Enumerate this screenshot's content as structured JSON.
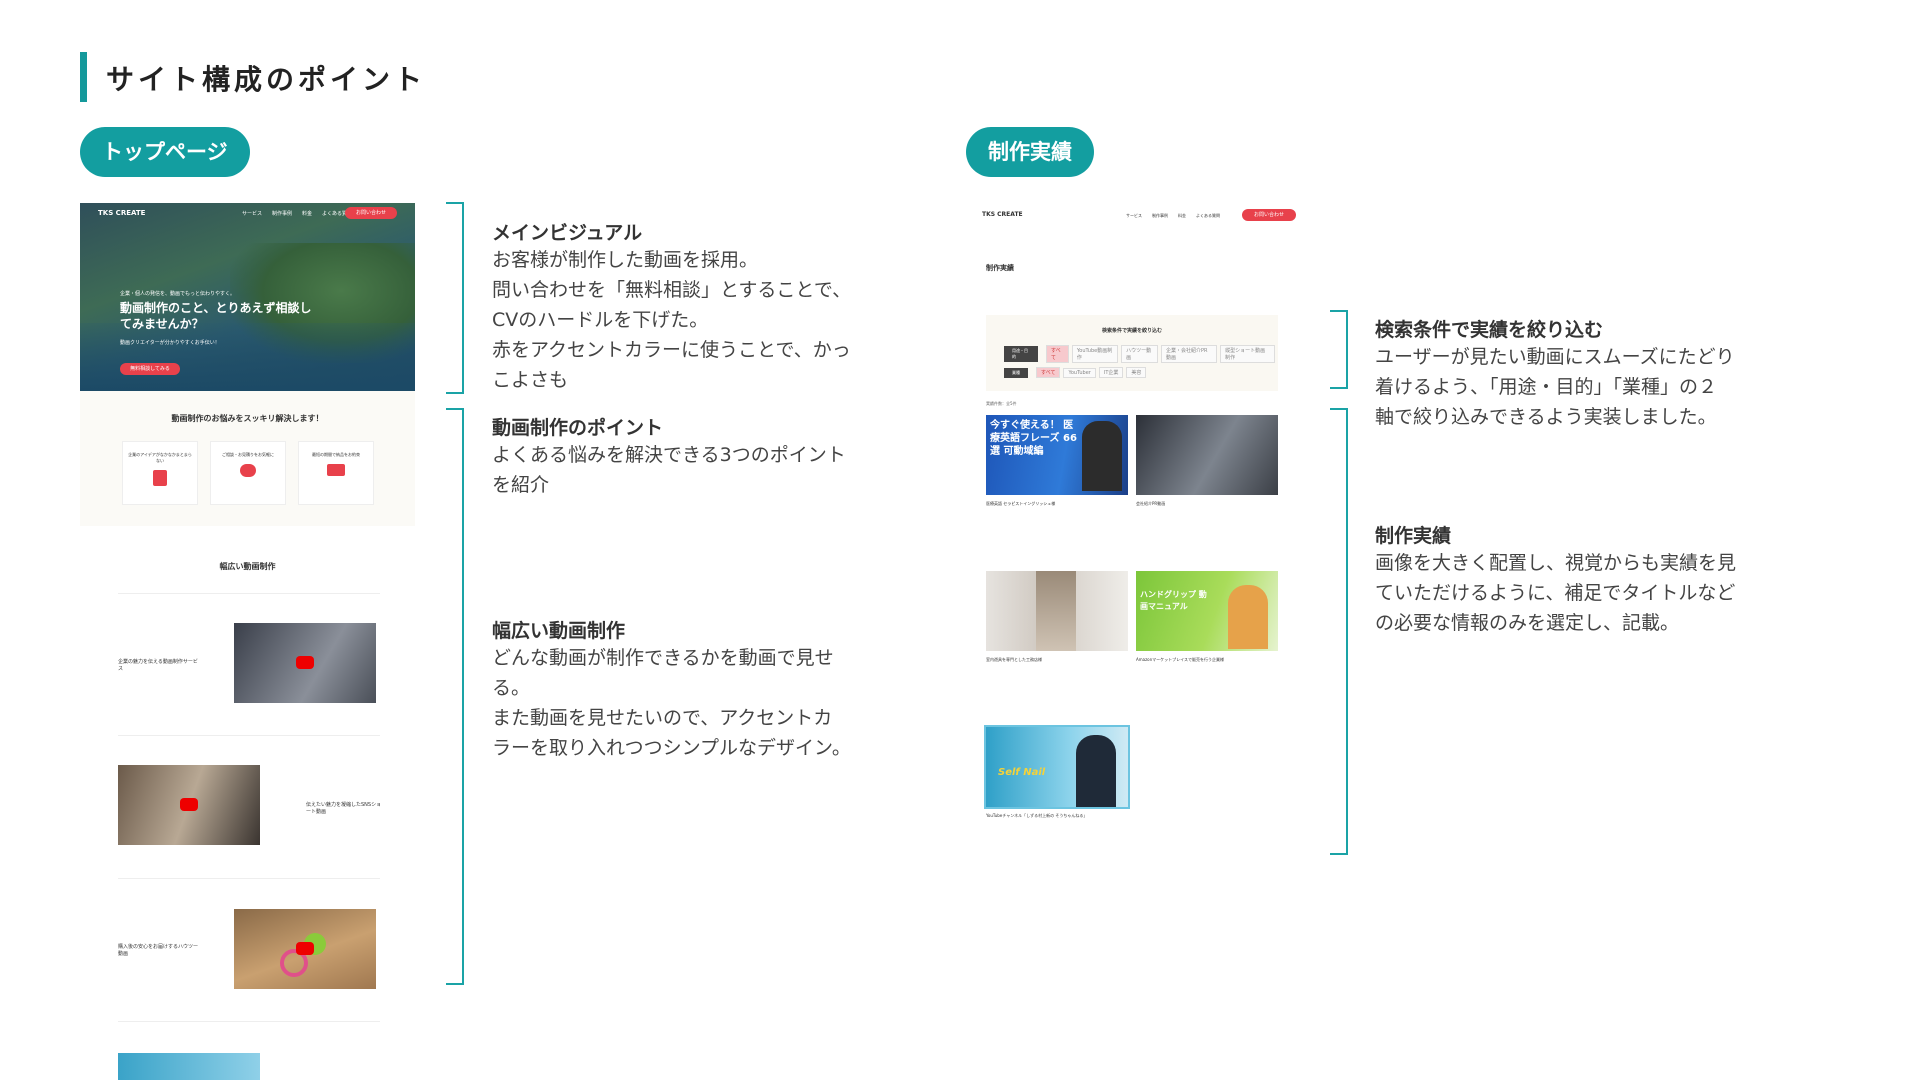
{
  "page": {
    "title": "サイト構成のポイント",
    "accent": "#139ea0"
  },
  "left": {
    "pill": "トップページ",
    "mock": {
      "logo": "TKS CREATE",
      "nav": [
        "サービス",
        "制作事例",
        "料金",
        "よくある質問"
      ],
      "cta": "お問い合わせ",
      "hero_small": "企業・個人の発信を、動画でもっと伝わりやすく。",
      "hero_title": "動画制作のこと、とりあえず相談してみませんか？",
      "hero_sub": "動画クリエイターが分かりやすくお手伝い！",
      "hero_btn": "無料相談してみる",
      "section1_title": "動画制作のお悩みをスッキリ解決します！",
      "points": [
        "企業のアイデアがなかなかまとまらない",
        "ご相談・お見積りをお気軽に",
        "最短の期間で納品をお約束"
      ],
      "section2_title": "幅広い動画制作",
      "works": [
        "企業の魅力を伝える動画制作サービス",
        "伝えたい魅力を凝縮したSNSショート動画",
        "購入後の安心をお届けするハウツー動画"
      ]
    },
    "annotations": [
      {
        "heading": "メインビジュアル",
        "body": [
          "お客様が制作した動画を採用。",
          "問い合わせを「無料相談」とすることで、",
          "CVのハードルを下げた。",
          "赤をアクセントカラーに使うことで、かっ",
          "こよさも"
        ]
      },
      {
        "heading": "動画制作のポイント",
        "body": [
          "よくある悩みを解決できる3つのポイント",
          "を紹介"
        ]
      },
      {
        "heading": "幅広い動画制作",
        "body": [
          "どんな動画が制作できるかを動画で見せ",
          "る。",
          "また動画を見せたいので、アクセントカ",
          "ラーを取り入れつつシンプルなデザイン。"
        ]
      }
    ]
  },
  "right": {
    "pill": "制作実績",
    "mock": {
      "logo": "TKS CREATE",
      "page_title": "制作実績",
      "filter_title": "検索条件で実績を絞り込む",
      "filter_rows": [
        {
          "label": "用途・目的",
          "tags": [
            "すべて",
            "YouTube動画制作",
            "ハウツー動画",
            "企業・会社紹介PR動画",
            "縦型ショート動画制作"
          ]
        },
        {
          "label": "業種",
          "tags": [
            "すべて",
            "YouTuber",
            "IT企業",
            "美容"
          ]
        }
      ],
      "count": "実績件数：全5件",
      "cards": [
        {
          "title": "医療英語 セラピストイングリッシュ様",
          "thumb_text": "今すぐ使える！ 医療英語フレーズ 66選 可動域編"
        },
        {
          "title": "会社紹介PR動画",
          "thumb_text": ""
        },
        {
          "title": "室内遊具を専門とした工務店様",
          "thumb_text": ""
        },
        {
          "title": "Amazonマーケットプレイスで販売を行う企業様",
          "thumb_text": "ハンドグリップ 動画マニュアル"
        },
        {
          "title": "YouTubeチャンネル「しずる村上新の そうちゃんねる」",
          "thumb_text": "Self Nail"
        }
      ]
    },
    "annotations": [
      {
        "heading": "検索条件で実績を絞り込む",
        "body": [
          "ユーザーが見たい動画にスムーズにたどり",
          "着けるよう、「用途・目的」「業種」の２",
          "軸で絞り込みできるよう実装しました。"
        ]
      },
      {
        "heading": "制作実績",
        "body": [
          "画像を大きく配置し、視覚からも実績を見",
          "ていただけるように、補足でタイトルなど",
          "の必要な情報のみを選定し、記載。"
        ]
      }
    ]
  }
}
